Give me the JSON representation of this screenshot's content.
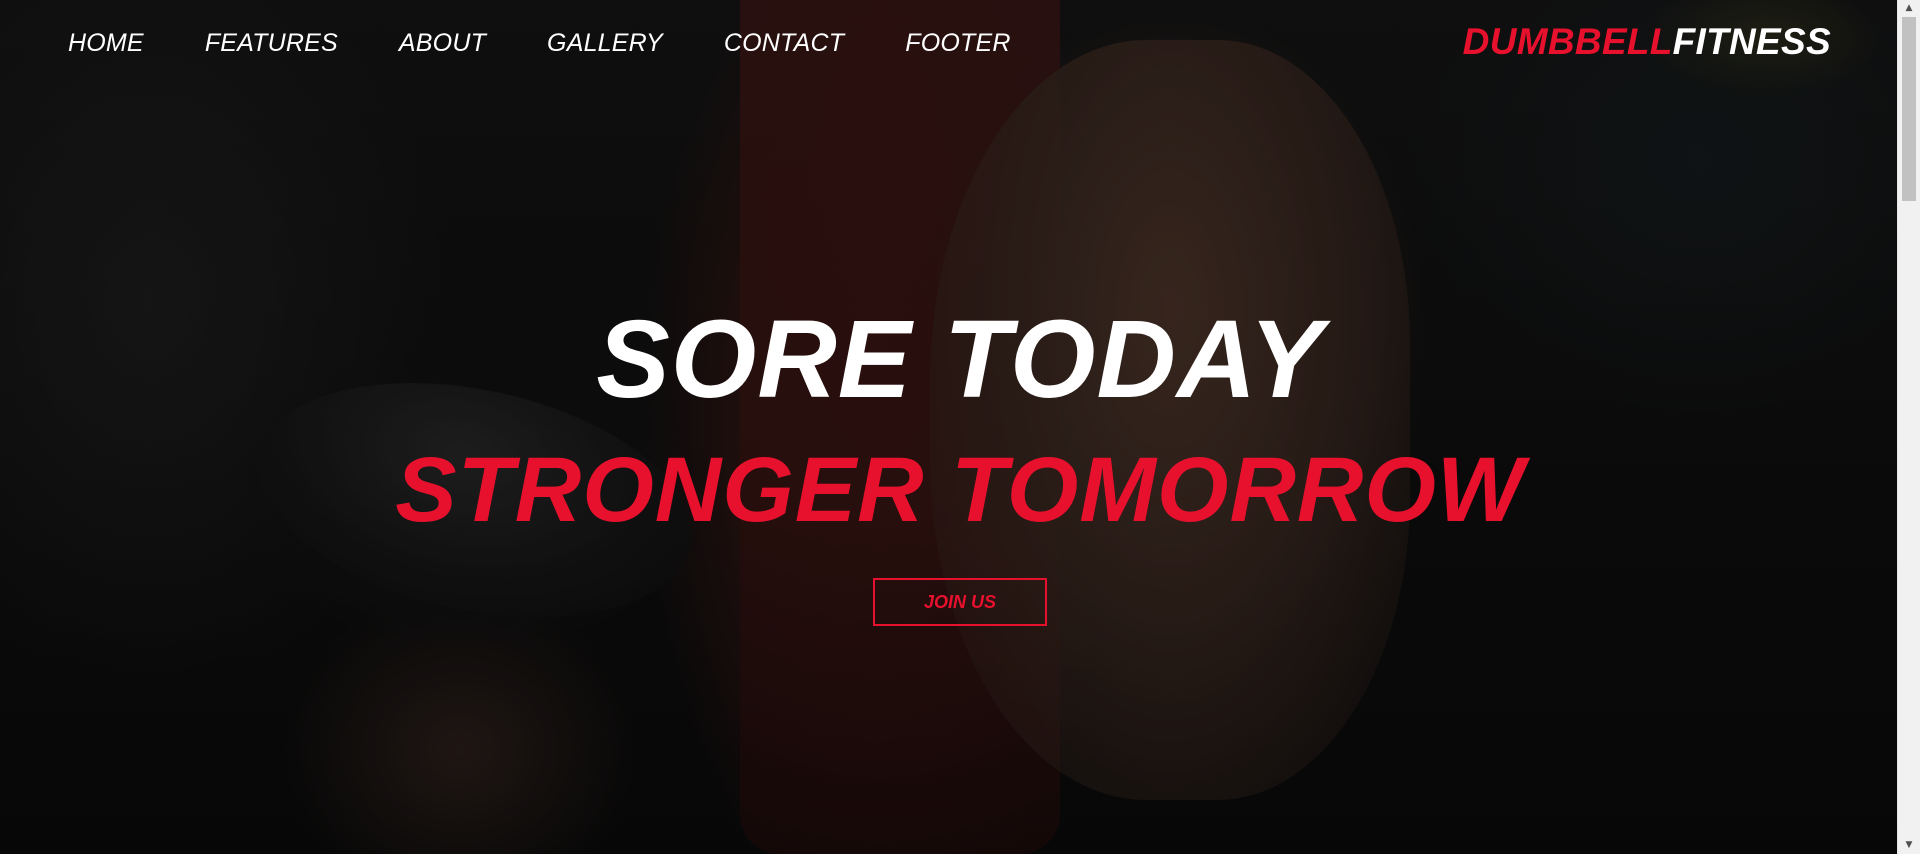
{
  "nav": {
    "links": [
      {
        "label": "HOME"
      },
      {
        "label": "FEATURES"
      },
      {
        "label": "ABOUT"
      },
      {
        "label": "GALLERY"
      },
      {
        "label": "CONTACT"
      },
      {
        "label": "FOOTER"
      }
    ]
  },
  "brand": {
    "part1": "DUMBBELL",
    "part2": "FITNESS"
  },
  "hero": {
    "headline_top": "SORE TODAY",
    "headline_bottom": "STRONGER TOMORROW",
    "cta_label": "JOIN US"
  },
  "colors": {
    "accent": "#e8112d",
    "text": "#ffffff",
    "background": "#0a0a0a"
  },
  "icons": {
    "scroll_up": "chevron-up-icon",
    "scroll_down": "chevron-down-icon"
  }
}
